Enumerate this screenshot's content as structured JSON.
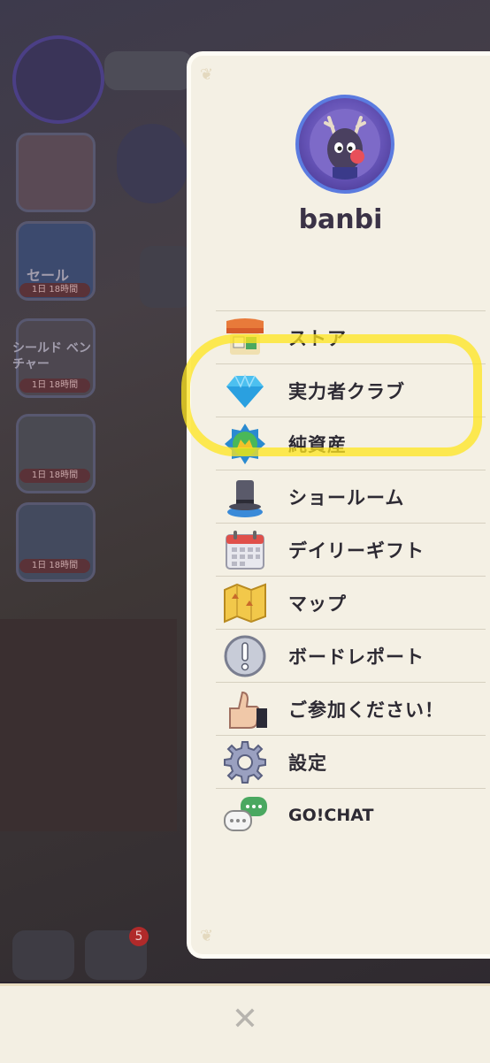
{
  "profile": {
    "username": "banbi"
  },
  "menu": {
    "items": [
      {
        "label": "ストア",
        "icon": "store-icon"
      },
      {
        "label": "実力者クラブ",
        "icon": "diamond-icon"
      },
      {
        "label": "純資産",
        "icon": "net-worth-badge-icon"
      },
      {
        "label": "ショールーム",
        "icon": "top-hat-icon"
      },
      {
        "label": "デイリーギフト",
        "icon": "calendar-icon"
      },
      {
        "label": "マップ",
        "icon": "map-icon"
      },
      {
        "label": "ボードレポート",
        "icon": "exclamation-icon"
      },
      {
        "label": "ご参加ください！",
        "icon": "thumbs-up-icon"
      },
      {
        "label": "設定",
        "icon": "gear-icon"
      },
      {
        "label": "GO!CHAT",
        "icon": "chat-bubbles-icon"
      }
    ]
  },
  "background": {
    "side_items": [
      {
        "label": "セール",
        "tag": "1日 18時間"
      },
      {
        "label": "シールド ベンチャー",
        "tag": "1日 18時間"
      },
      {
        "label": "",
        "tag": "1日 18時間"
      },
      {
        "label": "",
        "tag": "1日 18時間"
      }
    ],
    "notification_count": "5"
  },
  "colors": {
    "panel_bg": "#f4f0e4",
    "highlight": "#ffe61e",
    "avatar_ring": "#5b7be0"
  },
  "close_icon": "close-icon"
}
